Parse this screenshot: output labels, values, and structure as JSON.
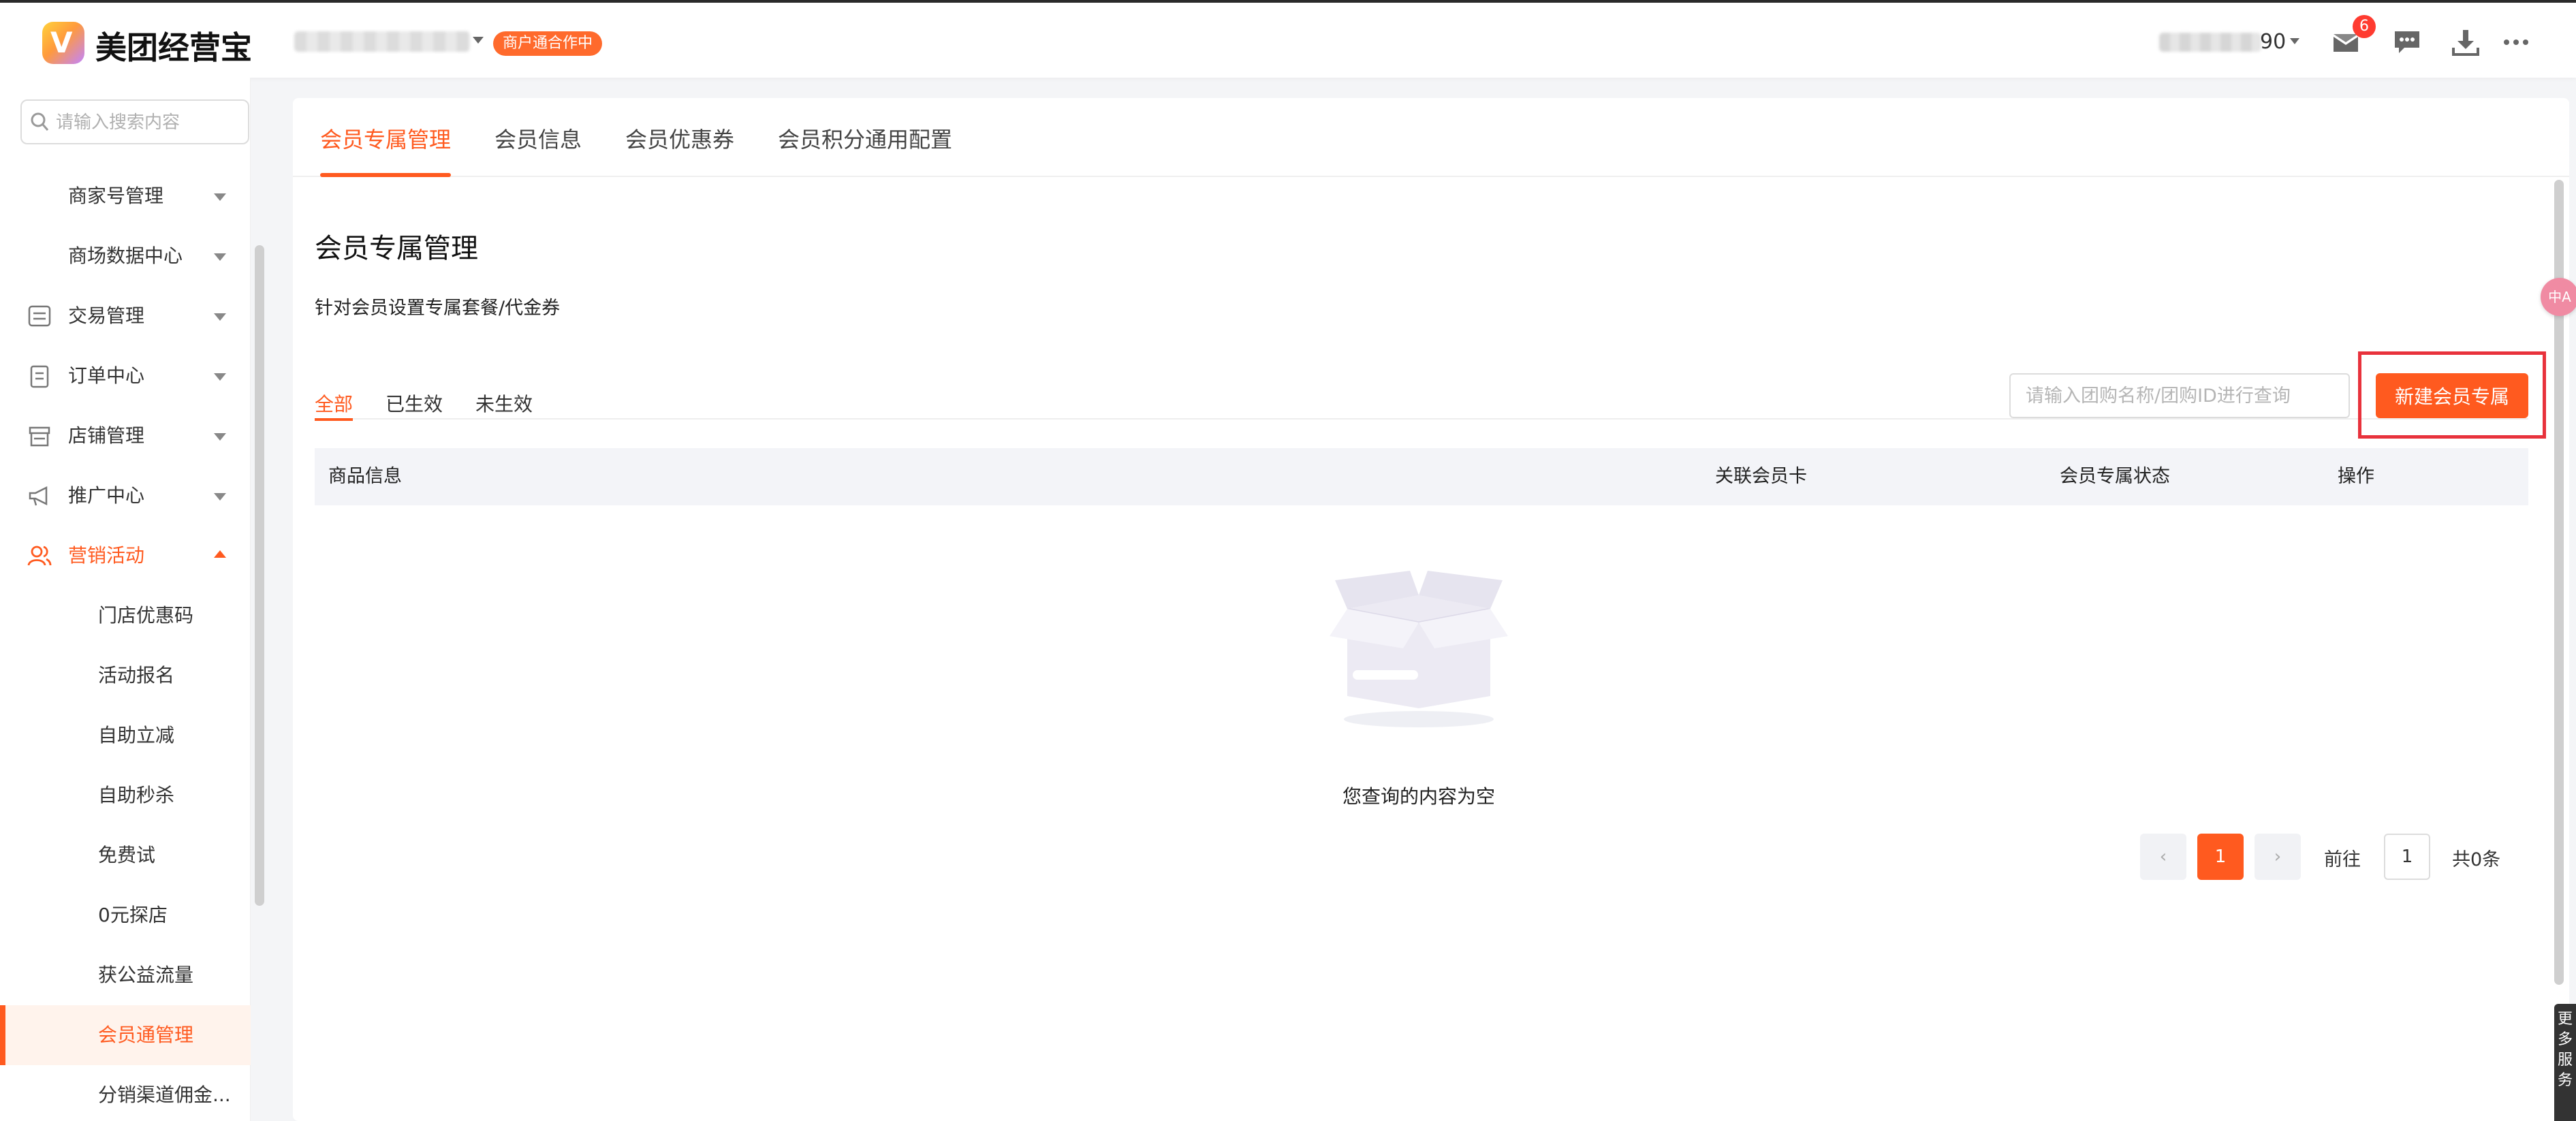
{
  "app": {
    "name": "美团经营宝",
    "logo_glyph": "V",
    "status_badge": "商户通合作中",
    "user_suffix": "90",
    "message_count": "6"
  },
  "colors": {
    "accent": "#ff5a1f",
    "highlight": "#e8323c",
    "badge": "#ff3b30"
  },
  "sidebar": {
    "search_placeholder": "请输入搜索内容",
    "items": [
      {
        "label": "商家号管理",
        "level": 2,
        "icon": ""
      },
      {
        "label": "商场数据中心",
        "level": 2,
        "icon": ""
      },
      {
        "label": "交易管理",
        "level": 1,
        "icon": "sliders-icon"
      },
      {
        "label": "订单中心",
        "level": 1,
        "icon": "clipboard-icon"
      },
      {
        "label": "店铺管理",
        "level": 1,
        "icon": "store-icon"
      },
      {
        "label": "推广中心",
        "level": 1,
        "icon": "megaphone-icon"
      },
      {
        "label": "营销活动",
        "level": 1,
        "icon": "users-icon",
        "expanded": true
      },
      {
        "label": "门店优惠码",
        "level": 3
      },
      {
        "label": "活动报名",
        "level": 3
      },
      {
        "label": "自助立减",
        "level": 3
      },
      {
        "label": "自助秒杀",
        "level": 3
      },
      {
        "label": "免费试",
        "level": 3
      },
      {
        "label": "0元探店",
        "level": 3
      },
      {
        "label": "获公益流量",
        "level": 3
      },
      {
        "label": "会员通管理",
        "level": 3,
        "active": true
      },
      {
        "label": "分销渠道佣金...",
        "level": 3
      }
    ]
  },
  "main": {
    "tabs": [
      "会员专属管理",
      "会员信息",
      "会员优惠券",
      "会员积分通用配置"
    ],
    "active_tab": 0,
    "title": "会员专属管理",
    "subtitle": "针对会员设置专属套餐/代金券",
    "filters": [
      "全部",
      "已生效",
      "未生效"
    ],
    "active_filter": 0,
    "search_placeholder": "请输入团购名称/团购ID进行查询",
    "create_button": "新建会员专属",
    "table_headers": [
      "商品信息",
      "关联会员卡",
      "会员专属状态",
      "操作"
    ],
    "empty_text": "您查询的内容为空",
    "pagination": {
      "current_page": "1",
      "goto_label": "前往",
      "goto_value": "1",
      "total_label": "共0条"
    }
  },
  "widgets": {
    "translate_label": "中A",
    "service_label": "更多服务"
  }
}
